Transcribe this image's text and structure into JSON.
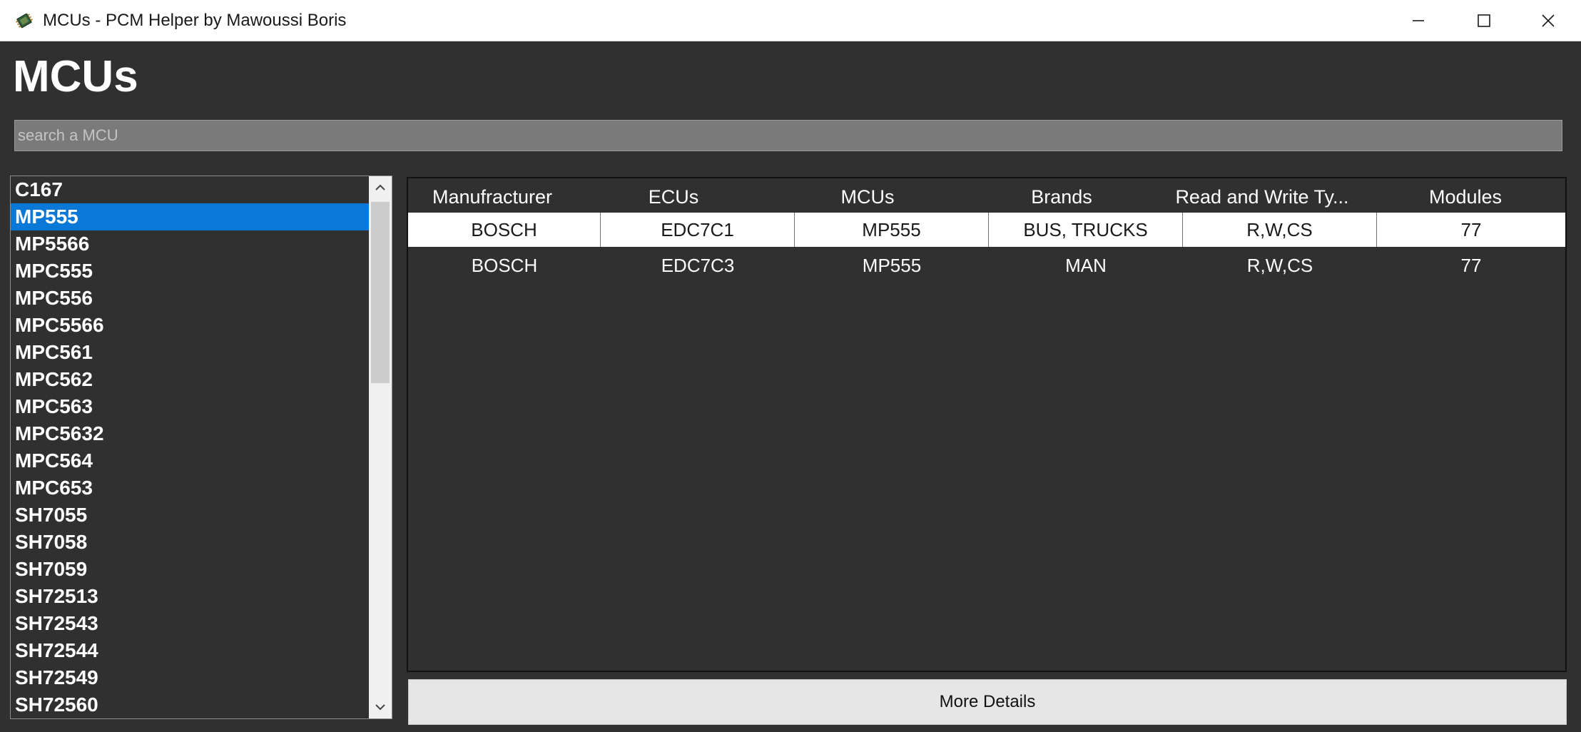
{
  "window": {
    "title": "MCUs - PCM Helper by Mawoussi Boris",
    "icon": "chip-icon",
    "controls": [
      "minimize-icon",
      "maximize-icon",
      "close-icon"
    ]
  },
  "page": {
    "title": "MCUs"
  },
  "search": {
    "placeholder": "search a MCU",
    "value": ""
  },
  "mcu_list": {
    "selected": "MP555",
    "items": [
      "C167",
      "MP555",
      "MP5566",
      "MPC555",
      "MPC556",
      "MPC5566",
      "MPC561",
      "MPC562",
      "MPC563",
      "MPC5632",
      "MPC564",
      "MPC653",
      "SH7055",
      "SH7058",
      "SH7059",
      "SH72513",
      "SH72543",
      "SH72544",
      "SH72549",
      "SH72560"
    ]
  },
  "table": {
    "columns": [
      "Manufracturer",
      "ECUs",
      "MCUs",
      "Brands",
      "Read and Write Ty...",
      "Modules"
    ],
    "rows": [
      [
        "BOSCH",
        "EDC7C1",
        "MP555",
        "BUS, TRUCKS",
        "R,W,CS",
        "77"
      ],
      [
        "BOSCH",
        "EDC7C3",
        "MP555",
        "MAN",
        "R,W,CS",
        "77"
      ]
    ],
    "selected_row": 0
  },
  "actions": {
    "more_details_label": "More Details"
  },
  "colors": {
    "background": "#303030",
    "selection": "#0a78d7",
    "search_bg": "#7a7a7a",
    "button_bg": "#e6e6e6"
  }
}
